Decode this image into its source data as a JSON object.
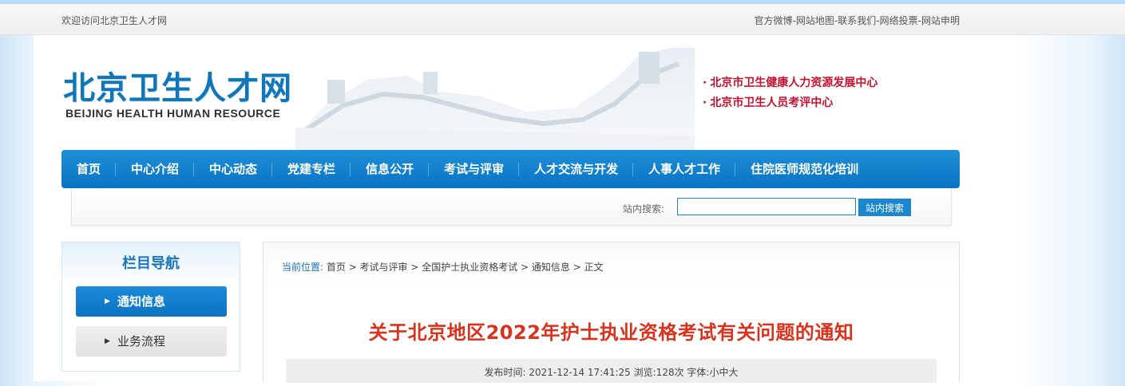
{
  "topbar": {
    "welcome": "欢迎访问北京卫生人才网",
    "links": [
      "官方微博",
      "网站地图",
      "联系我们",
      "网络投票",
      "网站申明"
    ],
    "separator": "-"
  },
  "header": {
    "logo_cn": "北京卫生人才网",
    "logo_en": "BEIJING HEALTH HUMAN RESOURCE",
    "bullet": "·",
    "centers": [
      "北京市卫生健康人力资源发展中心",
      "北京市卫生人员考评中心"
    ]
  },
  "nav": {
    "items": [
      "首页",
      "中心介绍",
      "中心动态",
      "党建专栏",
      "信息公开",
      "考试与评审",
      "人才交流与开发",
      "人事人才工作",
      "住院医师规范化培训"
    ]
  },
  "search": {
    "label": "站内搜索:",
    "value": "",
    "button": "站内搜索"
  },
  "sidebar": {
    "title": "栏目导航",
    "arrow": "▶",
    "items": [
      "通知信息",
      "业务流程"
    ]
  },
  "breadcrumb": {
    "label": "当前位置:",
    "path": "首页 > 考试与评审 > 全国护士执业资格考试 > 通知信息 > 正文"
  },
  "article": {
    "title": "关于北京地区2022年护士执业资格考试有关问题的通知",
    "meta": {
      "published_label": "发布时间:",
      "published": "2021-12-14 17:41:25",
      "views": "浏览:128次",
      "font_label": "字体:",
      "font_sizes": [
        "小",
        "中",
        "大"
      ]
    }
  },
  "colors": {
    "nav_blue": "#0a73c2",
    "logo_blue": "#1176b8",
    "title_red": "#d9331e",
    "center_red": "#c8102e"
  }
}
